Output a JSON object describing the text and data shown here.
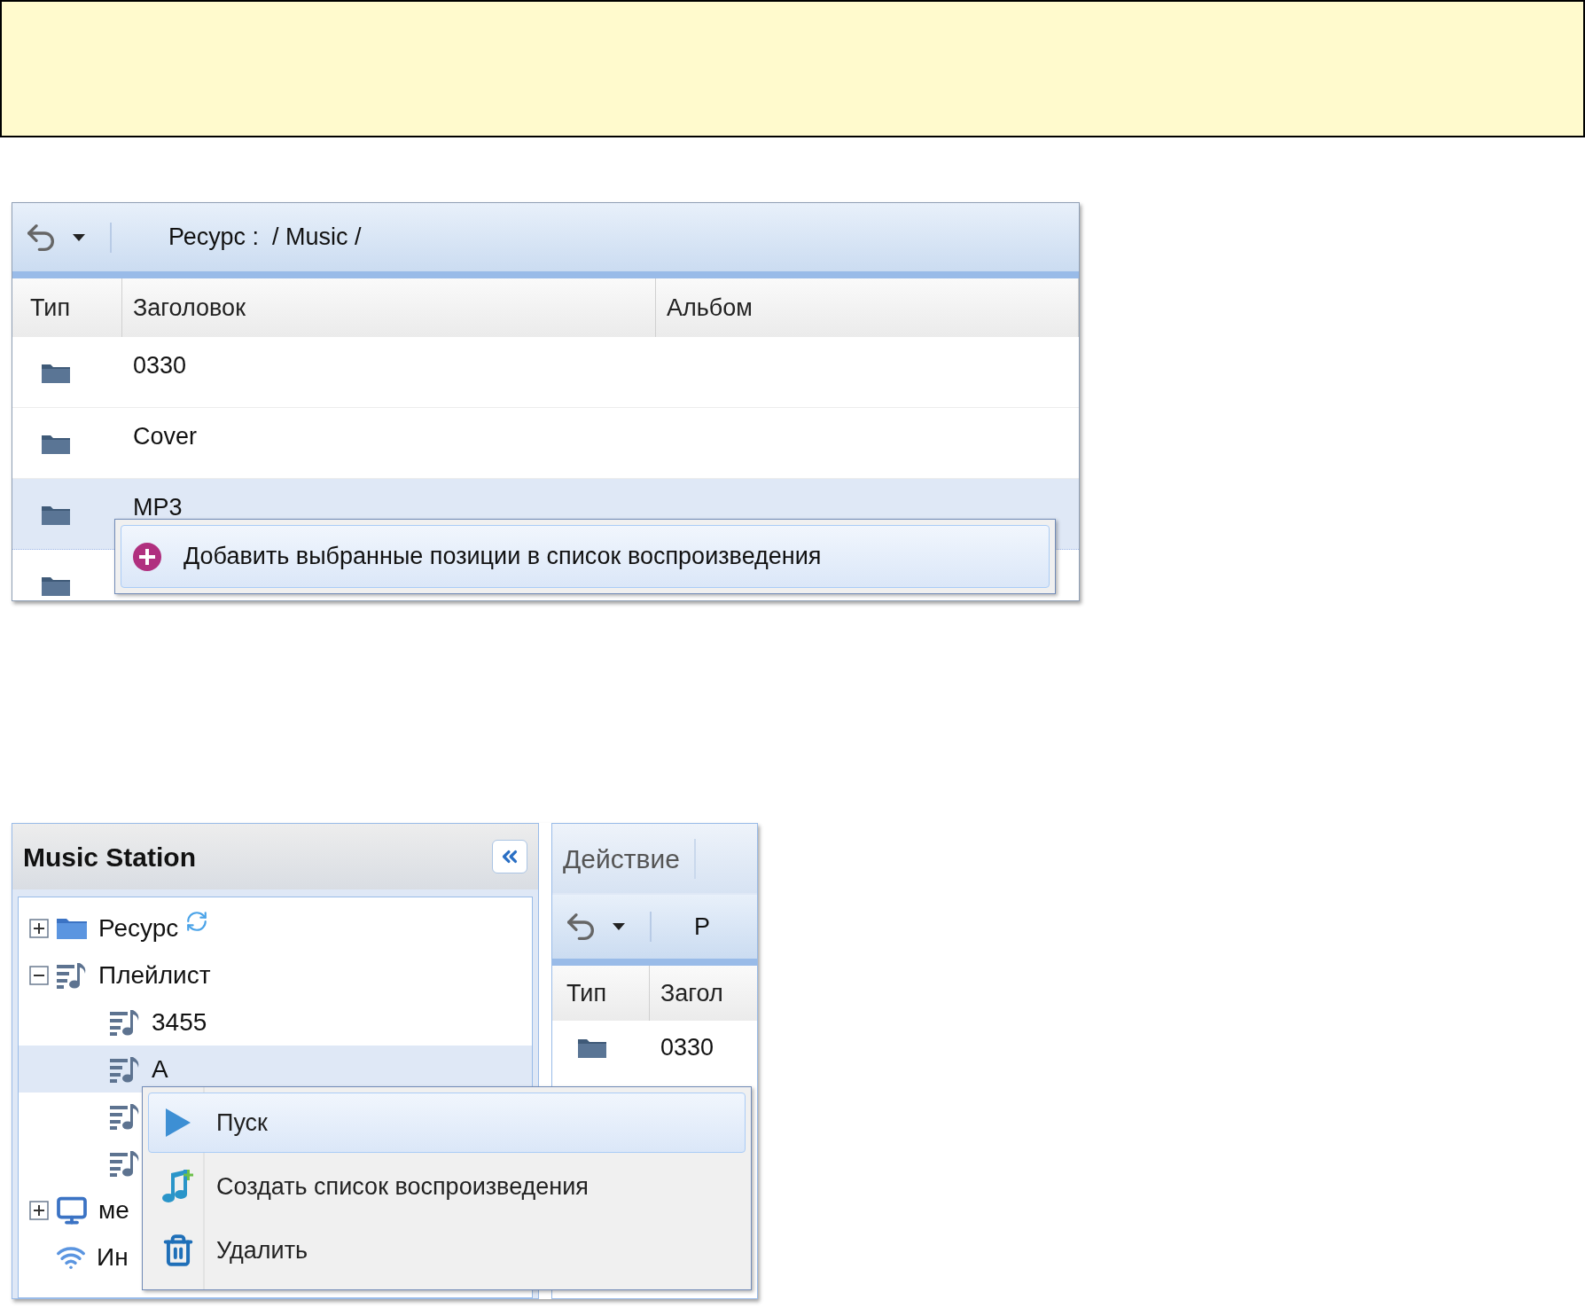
{
  "screenshot_1": {
    "toolbar": {
      "path": "Ресурс :  / Music /"
    },
    "table": {
      "columns": [
        "Тип",
        "Заголовок",
        "Альбом"
      ],
      "rows": [
        {
          "kind": "folder",
          "title": "0330",
          "selected": false
        },
        {
          "kind": "folder",
          "title": "Cover",
          "selected": false
        },
        {
          "kind": "folder",
          "title": "MP3",
          "selected": true
        },
        {
          "kind": "folder",
          "selected": false
        }
      ]
    },
    "context_menu": {
      "items": [
        {
          "kind": "add",
          "label": "Добавить выбранные позиции в список воспроизведения",
          "selected": true
        }
      ]
    }
  },
  "screenshot_2": {
    "panel": {
      "title": "Music Station",
      "tree": [
        {
          "kind": "folder",
          "label": "Ресурс",
          "expanded": false,
          "selected": false,
          "refresh": true
        },
        {
          "kind": "playlist",
          "label": "Плейлист",
          "expanded": true,
          "selected": false,
          "children": [
            {
              "kind": "playlist",
              "label": "3455",
              "selected": false
            },
            {
              "kind": "playlist",
              "label": "A",
              "selected": true
            },
            {
              "kind": "playlist",
              "selected": false
            },
            {
              "kind": "playlist",
              "selected": false
            }
          ]
        },
        {
          "kind": "server",
          "label": "ме",
          "expanded": false,
          "selected": false
        },
        {
          "kind": "wifi",
          "label": "Ин",
          "selected": false
        }
      ]
    },
    "right_panel": {
      "tab": "Действие",
      "toolbar_text": "Р",
      "columns": [
        "Тип",
        "Загол"
      ],
      "rows": [
        {
          "kind": "folder",
          "title": "0330"
        }
      ]
    },
    "context_menu": {
      "items": [
        {
          "kind": "play",
          "label": "Пуск",
          "selected": true
        },
        {
          "kind": "create",
          "label": "Создать список воспроизведения",
          "selected": false
        },
        {
          "kind": "delete",
          "label": "Удалить",
          "selected": false
        }
      ]
    }
  }
}
